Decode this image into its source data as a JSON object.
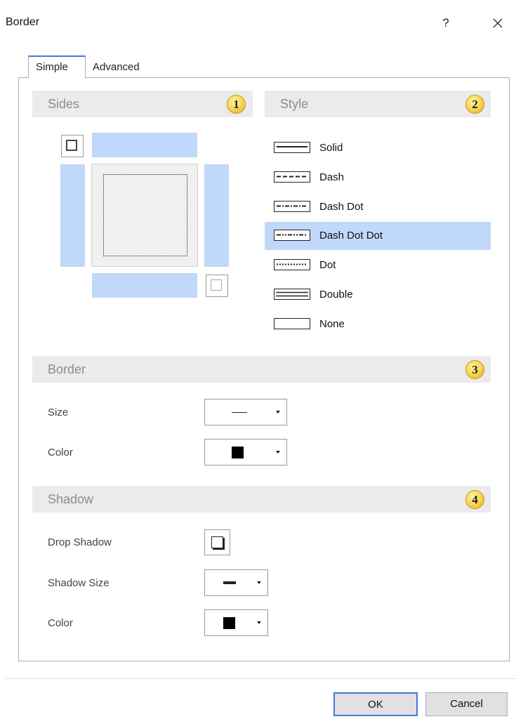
{
  "dialog": {
    "title": "Border",
    "help": "?",
    "close_icon": "close-icon"
  },
  "tabs": [
    {
      "label": "Simple",
      "active": true
    },
    {
      "label": "Advanced",
      "active": false
    }
  ],
  "sections": {
    "sides": {
      "title": "Sides",
      "badge": "1"
    },
    "style": {
      "title": "Style",
      "badge": "2"
    },
    "border": {
      "title": "Border",
      "badge": "3"
    },
    "shadow": {
      "title": "Shadow",
      "badge": "4"
    }
  },
  "styles": [
    {
      "label": "Solid",
      "line": "solid",
      "selected": false
    },
    {
      "label": "Dash",
      "line": "dash",
      "selected": false
    },
    {
      "label": "Dash Dot",
      "line": "dashdot",
      "selected": false
    },
    {
      "label": "Dash Dot Dot",
      "line": "dashdotdot",
      "selected": true
    },
    {
      "label": "Dot",
      "line": "dot",
      "selected": false
    },
    {
      "label": "Double",
      "line": "double",
      "selected": false
    },
    {
      "label": "None",
      "line": "none",
      "selected": false
    }
  ],
  "border": {
    "size_label": "Size",
    "color_label": "Color",
    "color_value": "#000000"
  },
  "shadow": {
    "drop_label": "Drop Shadow",
    "size_label": "Shadow Size",
    "color_label": "Color",
    "color_value": "#000000"
  },
  "buttons": {
    "ok": "OK",
    "cancel": "Cancel"
  },
  "colors": {
    "accent": "#3b7dd8",
    "selection": "#c0d8f9",
    "section_bg": "#ebebeb",
    "badge": "#f7d24a"
  }
}
